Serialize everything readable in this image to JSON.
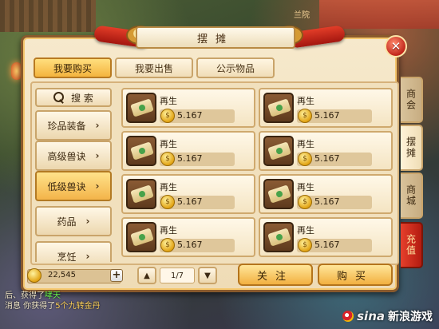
{
  "window": {
    "title": "摆摊",
    "close_label": "✕"
  },
  "top_tabs": [
    {
      "label": "我要购买",
      "active": true
    },
    {
      "label": "我要出售",
      "active": false
    },
    {
      "label": "公示物品",
      "active": false
    }
  ],
  "search": {
    "label": "搜 索"
  },
  "categories": [
    {
      "label": "珍品装备",
      "active": false
    },
    {
      "label": "高级兽诀",
      "active": false
    },
    {
      "label": "低级兽诀",
      "active": true
    },
    {
      "label": "药品",
      "active": false
    },
    {
      "label": "烹饪",
      "active": false
    }
  ],
  "items": [
    {
      "name": "再生",
      "price": "5.167"
    },
    {
      "name": "再生",
      "price": "5.167"
    },
    {
      "name": "再生",
      "price": "5.167"
    },
    {
      "name": "再生",
      "price": "5.167"
    },
    {
      "name": "再生",
      "price": "5.167"
    },
    {
      "name": "再生",
      "price": "5.167"
    },
    {
      "name": "再生",
      "price": "5.167"
    },
    {
      "name": "再生",
      "price": "5.167"
    }
  ],
  "money": {
    "value": "22,545",
    "add_label": "+"
  },
  "pagination": {
    "up": "▲",
    "down": "▼",
    "page": "1/7"
  },
  "buttons": {
    "follow": "关注",
    "buy": "购买"
  },
  "side_tabs": [
    {
      "label": "商会"
    },
    {
      "label": "摆摊"
    },
    {
      "label": "商城"
    },
    {
      "label": "充值"
    }
  ],
  "chat": {
    "line1_prefix": "后、获得了",
    "line1_item": "哮天",
    "line2_prefix": "消息 你获得了",
    "line2_item": "5个九转金丹"
  },
  "background": {
    "sign": "兰院"
  },
  "watermark": {
    "logo": "sina",
    "text": "新浪游戏"
  },
  "colors": {
    "panel": "#f6e9cc",
    "accent_gold": "#f4b43e",
    "border": "#8a5a2c",
    "recharge": "#c1271b"
  }
}
